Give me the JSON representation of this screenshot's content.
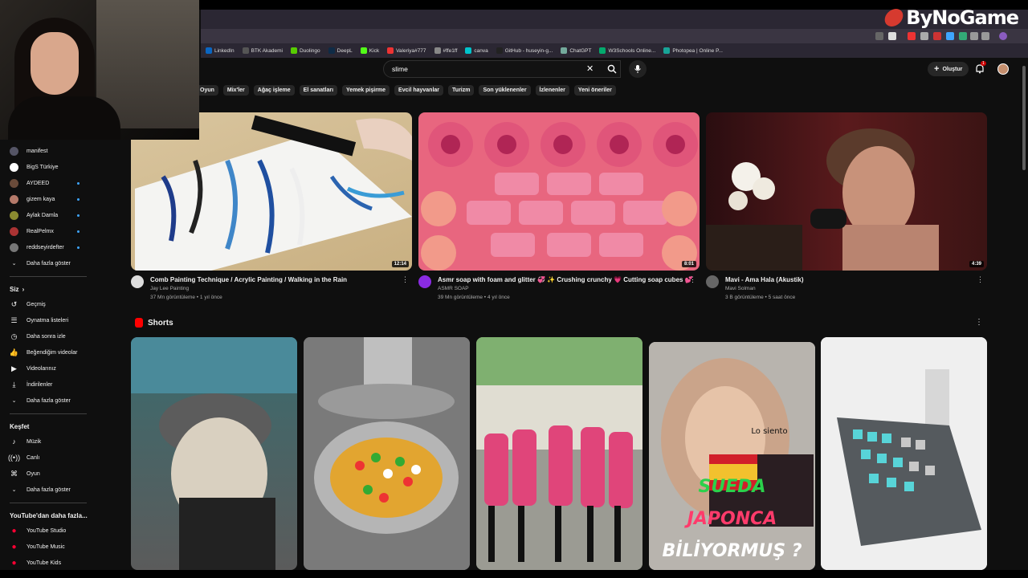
{
  "brand": {
    "name": "ByNoGame"
  },
  "bookmarks": [
    {
      "label": "LinkedIn",
      "color": "#0a66c2"
    },
    {
      "label": "BTK Akademi",
      "color": "#555"
    },
    {
      "label": "Duolingo",
      "color": "#58cc02"
    },
    {
      "label": "DeepL",
      "color": "#0f2b46"
    },
    {
      "label": "Kick",
      "color": "#53fc18"
    },
    {
      "label": "Valeriya#777",
      "color": "#e33"
    },
    {
      "label": "#ffe1ff",
      "color": "#888"
    },
    {
      "label": "canva",
      "color": "#00c4cc"
    },
    {
      "label": "GitHub - huseyin-g...",
      "color": "#222"
    },
    {
      "label": "ChatGPT",
      "color": "#74aa9c"
    },
    {
      "label": "W3Schools Online...",
      "color": "#04aa6d"
    },
    {
      "label": "Photopea | Online P...",
      "color": "#18a497"
    }
  ],
  "search": {
    "value": "slime",
    "clear_icon": "close-icon",
    "search_icon": "search-icon",
    "mic_icon": "mic-icon"
  },
  "header": {
    "create_label": "Oluştur",
    "notification_count": "1"
  },
  "chips": [
    "Oyun",
    "Mix'ler",
    "Ağaç işleme",
    "El sanatları",
    "Yemek pişirme",
    "Evcil hayvanlar",
    "Turizm",
    "Son yüklenenler",
    "İzlenenler",
    "Yeni öneriler"
  ],
  "sidebar": {
    "subscriptions": [
      {
        "label": "manifest",
        "color": "#556",
        "live": false
      },
      {
        "label": "BigS Türkiye",
        "color": "#fff",
        "live": false
      },
      {
        "label": "AYDEED",
        "color": "#6a4b3a",
        "live": true
      },
      {
        "label": "gizem kaya",
        "color": "#b57a6a",
        "live": true
      },
      {
        "label": "Aylak Damla",
        "color": "#8a8a30",
        "live": true
      },
      {
        "label": "RealPelmx",
        "color": "#a33",
        "live": true
      },
      {
        "label": "reddseyirdefter",
        "color": "#777",
        "live": true
      }
    ],
    "more1": "Daha fazla göster",
    "you_title": "Siz",
    "you_items": [
      {
        "label": "Geçmiş",
        "icon": "history-icon"
      },
      {
        "label": "Oynatma listeleri",
        "icon": "playlist-icon"
      },
      {
        "label": "Daha sonra izle",
        "icon": "watch-later-icon"
      },
      {
        "label": "Beğendiğim videolar",
        "icon": "like-icon"
      },
      {
        "label": "Videolarınız",
        "icon": "your-videos-icon"
      },
      {
        "label": "İndirilenler",
        "icon": "download-icon"
      }
    ],
    "more2": "Daha fazla göster",
    "explore_title": "Keşfet",
    "explore_items": [
      {
        "label": "Müzik",
        "icon": "music-icon"
      },
      {
        "label": "Canlı",
        "icon": "live-icon"
      },
      {
        "label": "Oyun",
        "icon": "gaming-icon"
      }
    ],
    "more3": "Daha fazla göster",
    "more_yt_title": "YouTube'dan daha fazla...",
    "more_yt_items": [
      {
        "label": "YouTube Studio",
        "icon": "youtube-studio-icon"
      },
      {
        "label": "YouTube Music",
        "icon": "youtube-music-icon"
      },
      {
        "label": "YouTube Kids",
        "icon": "youtube-kids-icon"
      }
    ]
  },
  "videos": [
    {
      "title": "Comb Painting Technique / Acrylic Painting / Walking in the Rain",
      "channel": "Jay Lee Painting",
      "stats": "37 Mn görüntüleme • 1 yıl önce",
      "duration": "12:14",
      "avatar_color": "#ddd"
    },
    {
      "title": "Asmr soap with foam and glitter 💞 ✨ Crushing crunchy 💗 Cutting soap cubes 💕",
      "channel": "ASMR SOAP",
      "stats": "39 Mn görüntüleme • 4 yıl önce",
      "duration": "8:01",
      "avatar_color": "#8a2be2"
    },
    {
      "title": "Mavi - Ama Hala (Akustik)",
      "channel": "Mavi Solman",
      "stats": "3 B görüntüleme • 5 saat önce",
      "duration": "4:39",
      "avatar_color": "#666"
    }
  ],
  "shorts": {
    "title": "Shorts",
    "overlays": {
      "line1": "Lo siento",
      "line2": "SUEDA",
      "line3": "JAPONCA",
      "line4": "BİLİYORMUŞ ?"
    }
  }
}
